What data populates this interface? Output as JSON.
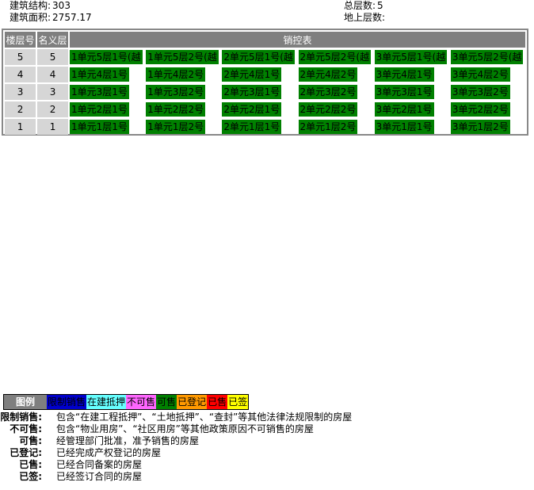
{
  "info": {
    "structure_label": "建筑结构:",
    "structure_value": "303",
    "area_label": "建筑面积:",
    "area_value": "2757.17",
    "total_floors_label": "总层数:",
    "total_floors_value": "5",
    "above_floors_label": "地上层数:",
    "above_floors_value": ""
  },
  "grid": {
    "col_floor": "楼层号",
    "col_nominal": "名义层",
    "col_sales": "销控表",
    "rows": [
      {
        "floor": "5",
        "nominal": "5",
        "units": [
          "1单元5层1号(越",
          "1单元5层2号(越",
          "2单元5层1号(越",
          "2单元5层2号(越",
          "3单元5层1号(越",
          "3单元5层2号(越"
        ]
      },
      {
        "floor": "4",
        "nominal": "4",
        "units": [
          "1单元4层1号",
          "1单元4层2号",
          "2单元4层1号",
          "2单元4层2号",
          "3单元4层1号",
          "3单元4层2号"
        ]
      },
      {
        "floor": "3",
        "nominal": "3",
        "units": [
          "1单元3层1号",
          "1单元3层2号",
          "2单元3层1号",
          "2单元3层2号",
          "3单元3层1号",
          "3单元3层2号"
        ]
      },
      {
        "floor": "2",
        "nominal": "2",
        "units": [
          "1单元2层1号",
          "1单元2层2号",
          "2单元2层1号",
          "2单元2层2号",
          "3单元2层1号",
          "3单元2层2号"
        ]
      },
      {
        "floor": "1",
        "nominal": "1",
        "units": [
          "1单元1层1号",
          "1单元1层2号",
          "2单元1层1号",
          "2单元1层2号",
          "3单元1层1号",
          "3单元1层2号"
        ]
      }
    ],
    "available_color": "#008000"
  },
  "legend": {
    "title": "图例",
    "items": [
      {
        "label": "限制销售",
        "color": "#0000cc"
      },
      {
        "label": "在建抵押",
        "color": "#66ffff"
      },
      {
        "label": "不可售",
        "color": "#ff66ff"
      },
      {
        "label": "可售",
        "color": "#008000"
      },
      {
        "label": "已登记",
        "color": "#ff9900"
      },
      {
        "label": "已售",
        "color": "#ff0000"
      },
      {
        "label": "已签",
        "color": "#ffff00"
      }
    ]
  },
  "definitions": [
    {
      "term": "限制销售:",
      "text": "包含“在建工程抵押”、“土地抵押”、“查封”等其他法律法规限制的房屋"
    },
    {
      "term": "不可售:",
      "text": "包含“物业用房”、“社区用房”等其他政策原因不可销售的房屋"
    },
    {
      "term": "可售:",
      "text": "经管理部门批准，准予销售的房屋"
    },
    {
      "term": "已登记:",
      "text": "已经完成产权登记的房屋"
    },
    {
      "term": "已售:",
      "text": "已经合同备案的房屋"
    },
    {
      "term": "已签:",
      "text": "已经签订合同的房屋"
    }
  ]
}
